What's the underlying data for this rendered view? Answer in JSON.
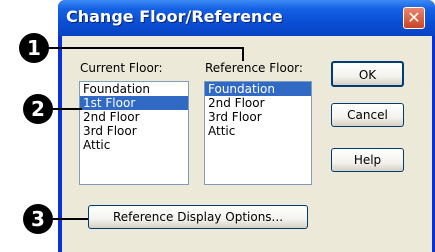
{
  "dialog": {
    "title": "Change Floor/Reference",
    "close_glyph": "✕"
  },
  "current_floor": {
    "label": "Current Floor:",
    "items": [
      "Foundation",
      "1st Floor",
      "2nd Floor",
      "3rd Floor",
      "Attic"
    ],
    "selected": "1st Floor"
  },
  "reference_floor": {
    "label": "Reference Floor:",
    "items": [
      "Foundation",
      "2nd Floor",
      "3rd Floor",
      "Attic"
    ],
    "selected": "Foundation"
  },
  "buttons": {
    "ok": "OK",
    "cancel": "Cancel",
    "help": "Help",
    "reference_display_options": "Reference Display Options..."
  },
  "callouts": [
    "1",
    "2",
    "3"
  ],
  "colors": {
    "titlebar": "#0a4fd6",
    "selection": "#316ac5",
    "dialog_bg": "#ece9d8",
    "close_button": "#c94424"
  }
}
